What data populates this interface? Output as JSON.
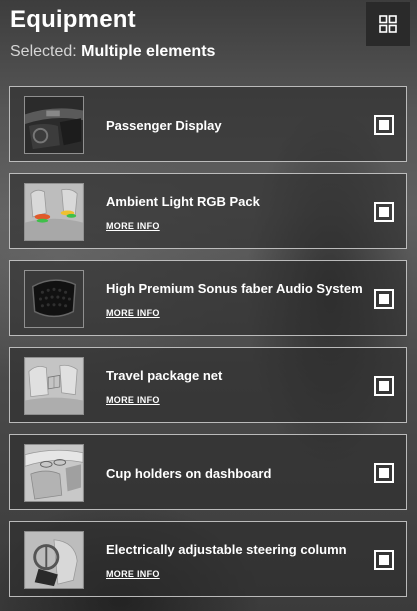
{
  "header": {
    "title": "Equipment",
    "selected_label": "Selected:",
    "selected_value": "Multiple elements",
    "view_toggle_icon": "grid-icon"
  },
  "items": [
    {
      "name": "Passenger Display",
      "more_info": "",
      "checked": true,
      "thumb_icon": "car-interior-dashboard-image"
    },
    {
      "name": "Ambient Light RGB Pack",
      "more_info": "MORE INFO",
      "checked": true,
      "thumb_icon": "car-seats-ambient-light-image"
    },
    {
      "name": "High Premium Sonus faber Audio System",
      "more_info": "MORE INFO",
      "checked": true,
      "thumb_icon": "speaker-grille-image"
    },
    {
      "name": "Travel package net",
      "more_info": "MORE INFO",
      "checked": true,
      "thumb_icon": "car-seats-net-image"
    },
    {
      "name": "Cup holders on dashboard",
      "more_info": "",
      "checked": true,
      "thumb_icon": "cup-holder-image"
    },
    {
      "name": "Electrically adjustable steering column",
      "more_info": "MORE INFO",
      "checked": true,
      "thumb_icon": "steering-column-image"
    }
  ],
  "colors": {
    "card_border": "#d2d2d2",
    "text": "#ffffff",
    "ambient_light_accent": "#e05a2a"
  }
}
